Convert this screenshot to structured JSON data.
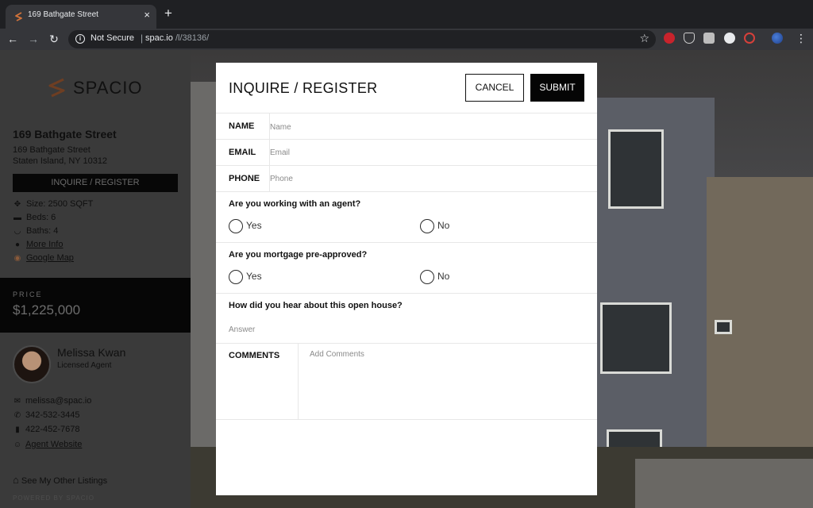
{
  "browser": {
    "tab_title": "169 Bathgate Street",
    "new_tab_symbol": "+",
    "close_symbol": "×",
    "security_label": "Not Secure",
    "url_separator": "|",
    "url_host": "spac.io",
    "url_path": "/l/38136/",
    "extensions": [
      "pinterest-icon",
      "pocket-icon",
      "evernote-icon",
      "onepassword-icon",
      "lastpass-icon",
      "globe-icon"
    ]
  },
  "sidebar": {
    "brand": "SPACIO",
    "brand_color": "#c2622d",
    "property_title": "169 Bathgate Street",
    "address_line1": "169 Bathgate Street",
    "address_line2": "Staten Island, NY 10312",
    "register_button": "INQUIRE / REGISTER",
    "features": {
      "size": "Size: 2500 SQFT",
      "beds": "Beds: 6",
      "baths": "Baths: 4",
      "more_info": "More Info",
      "google_map": "Google Map"
    },
    "price_label": "PRICE",
    "price_value": "$1,225,000",
    "agent": {
      "name": "Melissa Kwan",
      "role": "Licensed Agent",
      "email": "melissa@spac.io",
      "phone1": "342-532-3445",
      "phone2": "422-452-7678",
      "website": "Agent Website"
    },
    "other_listings": "See My Other Listings",
    "powered_by": "POWERED BY SPACIO"
  },
  "modal": {
    "title": "INQUIRE / REGISTER",
    "cancel_label": "CANCEL",
    "submit_label": "SUBMIT",
    "fields": {
      "name_label": "NAME",
      "name_placeholder": "Name",
      "email_label": "EMAIL",
      "email_placeholder": "Email",
      "phone_label": "PHONE",
      "phone_placeholder": "Phone"
    },
    "q_agent": {
      "question": "Are you working with an agent?",
      "yes": "Yes",
      "no": "No"
    },
    "q_mortgage": {
      "question": "Are you mortgage pre-approved?",
      "yes": "Yes",
      "no": "No"
    },
    "q_source": {
      "question": "How did you hear about this open house?",
      "placeholder": "Answer"
    },
    "comments_label": "COMMENTS",
    "comments_placeholder": "Add Comments"
  }
}
